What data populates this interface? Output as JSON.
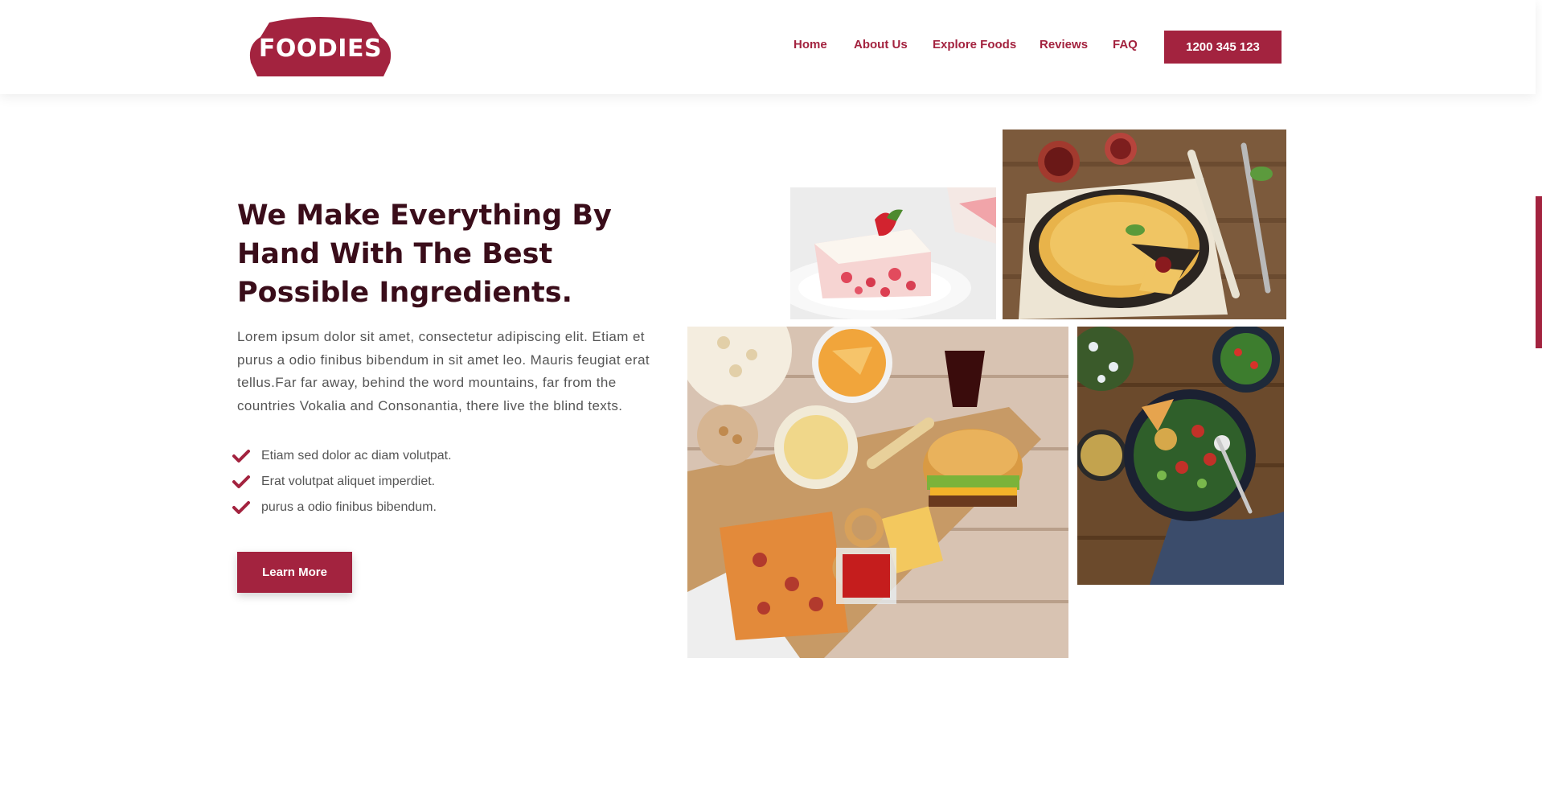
{
  "brand": {
    "logo_text": "FOODIES",
    "accent_color": "#a3233f",
    "heading_color": "#3a0d1a"
  },
  "nav": {
    "items": [
      {
        "label": "Home"
      },
      {
        "label": "About Us"
      },
      {
        "label": "Explore Foods"
      },
      {
        "label": "Reviews"
      },
      {
        "label": "FAQ"
      }
    ],
    "phone": "1200 345 123"
  },
  "hero": {
    "headline": "We Make Everything By Hand With The Best Possible Ingredients.",
    "paragraph": "Lorem ipsum dolor sit amet, consectetur adipiscing elit. Etiam et purus a odio finibus bibendum in sit amet leo. Mauris feugiat erat tellus.Far far away, behind the word mountains, far from the countries Vokalia and Consonantia, there live the blind texts.",
    "checklist": [
      "Etiam sed dolor ac diam volutpat.",
      "Erat volutpat aliquet imperdiet.",
      "purus a odio finibus bibendum."
    ],
    "button_label": "Learn More",
    "check_icon": "check-icon"
  },
  "photos": [
    {
      "name": "strawberry-cake-photo"
    },
    {
      "name": "quiche-pie-photo"
    },
    {
      "name": "fast-food-platter-photo"
    },
    {
      "name": "salad-bowl-photo"
    }
  ]
}
